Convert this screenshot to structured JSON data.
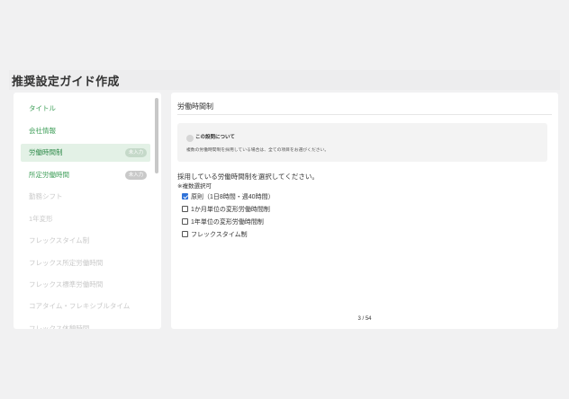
{
  "header": {
    "title": "推奨設定ガイド作成"
  },
  "sidebar": {
    "items": [
      {
        "label": "タイトル",
        "state": "done",
        "badge": ""
      },
      {
        "label": "会社情報",
        "state": "done",
        "badge": ""
      },
      {
        "label": "労働時間制",
        "state": "active",
        "badge": "未入力"
      },
      {
        "label": "所定労働時間",
        "state": "todo",
        "badge": "未入力"
      },
      {
        "label": "勤務シフト",
        "state": "disabled",
        "badge": ""
      },
      {
        "label": "1年変形",
        "state": "disabled",
        "badge": ""
      },
      {
        "label": "フレックスタイム制",
        "state": "disabled",
        "badge": ""
      },
      {
        "label": "フレックス所定労働時間",
        "state": "disabled",
        "badge": ""
      },
      {
        "label": "フレックス標準労働時間",
        "state": "disabled",
        "badge": ""
      },
      {
        "label": "コアタイム・フレキシブルタイム",
        "state": "disabled",
        "badge": ""
      },
      {
        "label": "フレックス休憩時間",
        "state": "disabled",
        "badge": ""
      }
    ]
  },
  "main": {
    "section_title": "労働時間制",
    "info": {
      "title": "この設問について",
      "text": "複数の労働時間制を採用している場合は、全ての項目をお選びください。"
    },
    "question": "採用している労働時間制を選択してください。",
    "note": "※複数選択可",
    "options": [
      {
        "label": "原則（1日8時間・週40時間）",
        "checked": true
      },
      {
        "label": "1か月単位の変形労働時間制",
        "checked": false
      },
      {
        "label": "1年単位の変形労働時間制",
        "checked": false
      },
      {
        "label": "フレックスタイム制",
        "checked": false
      }
    ],
    "pager": "3 / 54"
  },
  "colors": {
    "accent": "#3e9e58",
    "active_bg": "#e3f1e6",
    "checkbox": "#2f72d8"
  }
}
